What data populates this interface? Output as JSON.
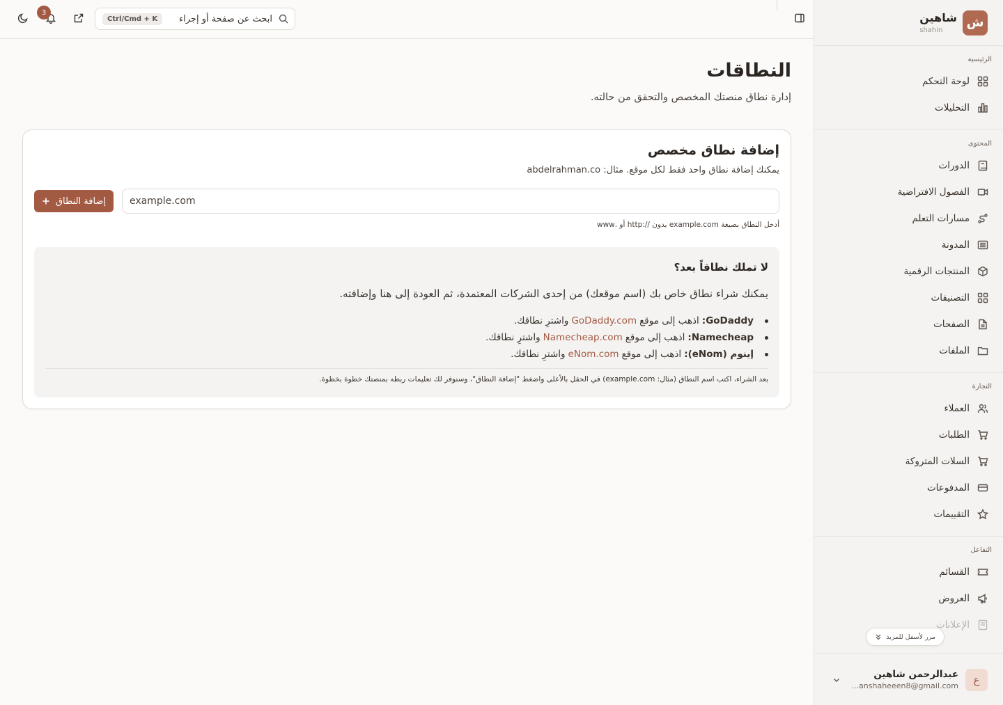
{
  "brand": {
    "logo_letter": "ش",
    "name": "شاهين",
    "sub": "shahin"
  },
  "sidebar": {
    "sections": [
      {
        "title": "الرئيسية",
        "items": [
          {
            "label": "لوحة التحكم",
            "icon": "dashboard-icon"
          },
          {
            "label": "التحليلات",
            "icon": "analytics-icon"
          }
        ]
      },
      {
        "title": "المحتوى",
        "items": [
          {
            "label": "الدورات",
            "icon": "book-icon"
          },
          {
            "label": "الفصول الافتراضية",
            "icon": "video-icon"
          },
          {
            "label": "مسارات التعلم",
            "icon": "route-icon"
          },
          {
            "label": "المدونة",
            "icon": "newspaper-icon"
          },
          {
            "label": "المنتجات الرقمية",
            "icon": "package-icon"
          },
          {
            "label": "التصنيفات",
            "icon": "grid-icon"
          },
          {
            "label": "الصفحات",
            "icon": "file-icon"
          },
          {
            "label": "الملفات",
            "icon": "folder-icon"
          }
        ]
      },
      {
        "title": "التجارة",
        "items": [
          {
            "label": "العملاء",
            "icon": "users-icon"
          },
          {
            "label": "الطلبات",
            "icon": "cart-icon"
          },
          {
            "label": "السلات المتروكة",
            "icon": "cart-icon"
          },
          {
            "label": "المدفوعات",
            "icon": "card-icon"
          },
          {
            "label": "التقييمات",
            "icon": "star-icon"
          }
        ]
      },
      {
        "title": "التفاعل",
        "items": [
          {
            "label": "القسائم",
            "icon": "ticket-icon"
          },
          {
            "label": "العروض",
            "icon": "megaphone-icon"
          },
          {
            "label": "الإعلانات",
            "icon": "ad-icon"
          }
        ]
      }
    ],
    "scroll_more": "مرر لأسفل للمزيد"
  },
  "user": {
    "avatar_letter": "ع",
    "name": "عبدالرحمن شاهين",
    "email": "anshaheeen8@gmail.com..."
  },
  "topbar": {
    "search_placeholder": "ابحث عن صفحة أو إجراء",
    "shortcut": "Ctrl/Cmd + K",
    "notifications_count": "3"
  },
  "page": {
    "title": "النطاقات",
    "subtitle": "إدارة نطاق منصتك المخصص والتحقق من حالته."
  },
  "card": {
    "title": "إضافة نطاق مخصص",
    "description": "يمكنك إضافة نطاق واحد فقط لكل موقع. مثال: abdelrahman.co",
    "input_placeholder": "example.com",
    "add_button": "إضافة النطاق",
    "hint": "أدخل النطاق بصيغة example.com بدون //:http أو .www"
  },
  "info": {
    "title": "لا تملك نطاقاً بعد؟",
    "text": "يمكنك شراء نطاق خاص بك (اسم موقعك) من إحدى الشركات المعتمدة، ثم العودة إلى هنا وإضافته.",
    "registrars": [
      {
        "name": "GoDaddy:",
        "pre": "اذهب إلى موقع",
        "link": "GoDaddy.com",
        "post": "واشترِ نطاقك."
      },
      {
        "name": "Namecheap:",
        "pre": "اذهب إلى موقع",
        "link": "Namecheap.com",
        "post": "واشترِ نطاقك."
      },
      {
        "name": "إينوم (eNom):",
        "pre": "اذهب إلى موقع",
        "link": "eNom.com",
        "post": "واشترِ نطاقك."
      }
    ],
    "note": "بعد الشراء، اكتب اسم النطاق (مثال: example.com) في الحقل بالأعلى واضغط \"إضافة النطاق\"، وسنوفر لك تعليمات ربطه بمنصتك خطوة بخطوة."
  },
  "colors": {
    "accent": "#a35a43",
    "brand": "#b06a52",
    "sidebar_bg": "#f5f3f1",
    "page_bg": "#fbfaf9"
  }
}
